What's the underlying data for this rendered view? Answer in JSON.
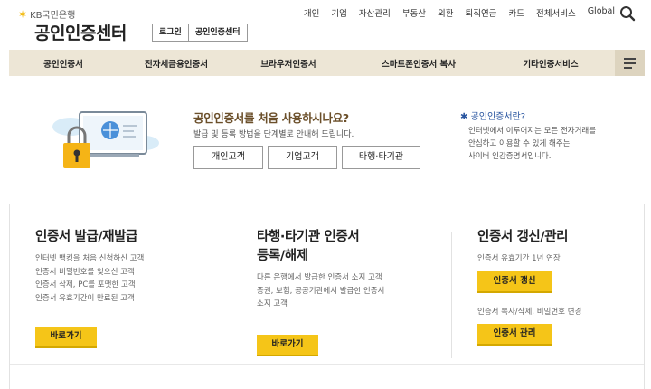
{
  "header": {
    "brand": "KB국민은행",
    "site_title": "공인인증센터",
    "login_label": "로그인",
    "cert_center_label": "공인인증센터",
    "topnav": [
      "개인",
      "기업",
      "자산관리",
      "부동산",
      "외환",
      "퇴직연금",
      "카드",
      "전체서비스",
      "Global"
    ],
    "search_icon": "search-icon"
  },
  "menu": {
    "items": [
      "공인인증서",
      "전자세금용인증서",
      "브라우저인증서",
      "스마트폰인증서 복사",
      "기타인증서비스"
    ],
    "toggle_icon": "hamburger-icon"
  },
  "intro": {
    "question": "공인인증서를 처음 사용하시나요?",
    "sub": "발급 및 등록 방법을 단계별로 안내해 드립니다.",
    "buttons": [
      "개인고객",
      "기업고객",
      "타행·타기관"
    ],
    "whatis_title": "공인인증서란?",
    "whatis_lines": [
      "인터넷에서 이루어지는 모든 전자거래를",
      "안심하고 이용할 수 있게 해주는",
      "사이버 인감증명서입니다."
    ]
  },
  "cards": {
    "issue": {
      "title": "인증서 발급/재발급",
      "lines": [
        "인터넷 뱅킹을 처음 신청하신 고객",
        "인증서 비밀번호를 잊으신 고객",
        "인증서 삭제, PC를 포맷한 고객",
        "인증서 유효기간이 만료된 고객"
      ],
      "button": "바로가기"
    },
    "other": {
      "title_line1": "타행·타기관 인증서",
      "title_line2": "등록/해제",
      "lines": [
        "다른 은행에서 발급한 인증서 소지 고객",
        "증권, 보험, 공공기관에서 발급한 인증서",
        "소지 고객"
      ],
      "button": "바로가기"
    },
    "manage": {
      "title": "인증서 갱신/관리",
      "renew_desc": "인증서 유효기간 1년 연장",
      "renew_button": "인증서 갱신",
      "manage_desc": "인증서 복사/삭제, 비밀번호 변경",
      "manage_button": "인증서 관리"
    }
  },
  "colors": {
    "menu_bg": "#ede6d6",
    "accent_yellow": "#f5c518",
    "question_brown": "#6b4f2a",
    "link_blue": "#2a56a0"
  }
}
